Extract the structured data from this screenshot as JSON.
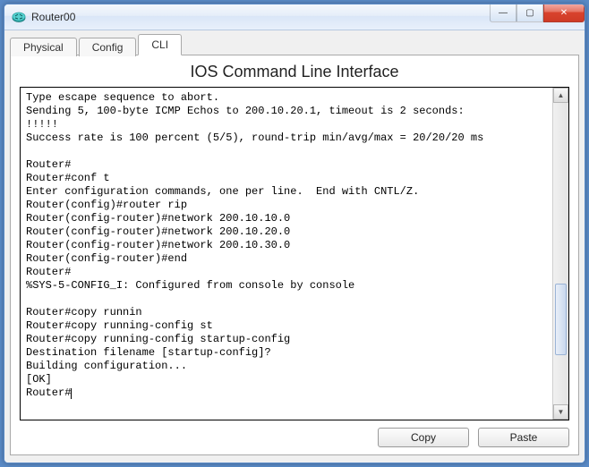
{
  "window": {
    "title": "Router00"
  },
  "tabs": {
    "physical": "Physical",
    "config": "Config",
    "cli": "CLI"
  },
  "page": {
    "title": "IOS Command Line Interface"
  },
  "terminal": {
    "lines": [
      "Type escape sequence to abort.",
      "Sending 5, 100-byte ICMP Echos to 200.10.20.1, timeout is 2 seconds:",
      "!!!!!",
      "Success rate is 100 percent (5/5), round-trip min/avg/max = 20/20/20 ms",
      "",
      "Router#",
      "Router#conf t",
      "Enter configuration commands, one per line.  End with CNTL/Z.",
      "Router(config)#router rip",
      "Router(config-router)#network 200.10.10.0",
      "Router(config-router)#network 200.10.20.0",
      "Router(config-router)#network 200.10.30.0",
      "Router(config-router)#end",
      "Router#",
      "%SYS-5-CONFIG_I: Configured from console by console",
      "",
      "Router#copy runnin",
      "Router#copy running-config st",
      "Router#copy running-config startup-config",
      "Destination filename [startup-config]?",
      "Building configuration...",
      "[OK]",
      "Router#"
    ]
  },
  "buttons": {
    "copy": "Copy",
    "paste": "Paste"
  },
  "window_controls": {
    "min": "—",
    "max": "▢",
    "close": "✕"
  },
  "scroll": {
    "up": "▲",
    "down": "▼"
  }
}
